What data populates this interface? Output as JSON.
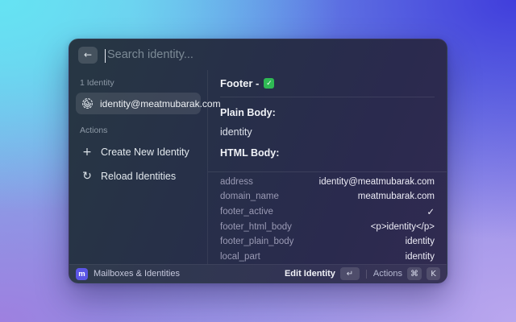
{
  "search": {
    "placeholder": "Search identity...",
    "back_icon": "←"
  },
  "sidebar": {
    "identities_section_label": "1 Identity",
    "identity": {
      "label": "identity@meatmubarak.com"
    },
    "actions_section_label": "Actions",
    "actions": [
      {
        "icon": "+",
        "label": "Create New Identity"
      },
      {
        "icon": "↻",
        "label": "Reload Identities"
      }
    ]
  },
  "detail": {
    "title": "Footer -",
    "title_check": "✓",
    "plain_body_label": "Plain Body:",
    "plain_body_value": "identity",
    "html_body_label": "HTML Body:",
    "rows": [
      {
        "key": "address",
        "value": "identity@meatmubarak.com"
      },
      {
        "key": "domain_name",
        "value": "meatmubarak.com"
      },
      {
        "key": "footer_active",
        "value": "✓"
      },
      {
        "key": "footer_html_body",
        "value": "<p>identity</p>"
      },
      {
        "key": "footer_plain_body",
        "value": "identity"
      },
      {
        "key": "local_part",
        "value": "identity"
      }
    ]
  },
  "footer": {
    "app_icon_letter": "m",
    "app_label": "Mailboxes & Identities",
    "primary_action": "Edit Identity",
    "primary_key": "↵",
    "secondary_action": "Actions",
    "modifier_key": "⌘",
    "letter_key": "K"
  }
}
